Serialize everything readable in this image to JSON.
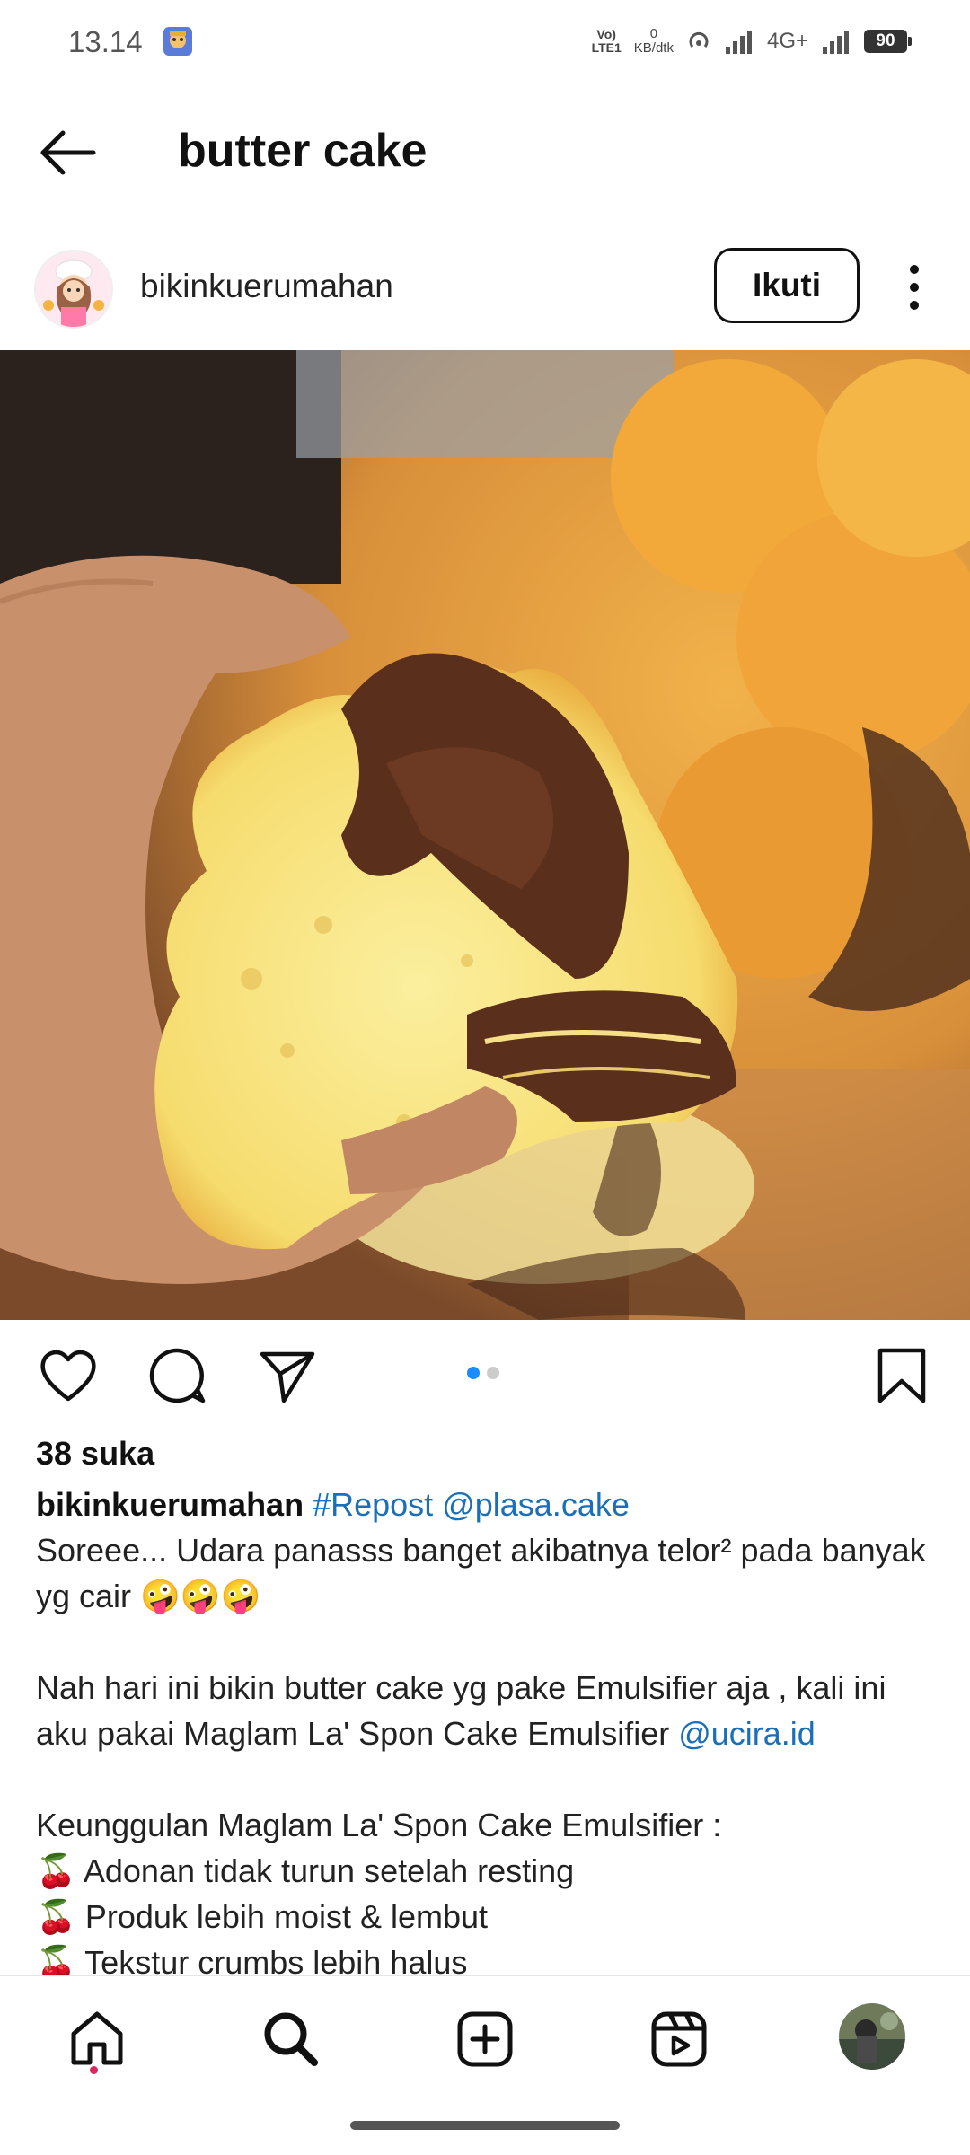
{
  "status_bar": {
    "time": "13.14",
    "volte": "Vo)\nLTE1",
    "speed_value": "0",
    "speed_unit": "KB/dtk",
    "network": "4G+",
    "battery": "90"
  },
  "header": {
    "title": "butter cake"
  },
  "post": {
    "username": "bikinkuerumahan",
    "follow_label": "Ikuti",
    "likes": "38 suka",
    "carousel": {
      "index": 1,
      "total": 2
    },
    "caption": {
      "author": "bikinkuerumahan",
      "hashtag": "#Repost",
      "mention1": "@plasa.cake",
      "line1": "Soreee... Udara panasss banget akibatnya telor² pada banyak yg cair 🤪🤪🤪",
      "line2": "Nah hari ini bikin butter cake yg pake Emulsifier aja , kali ini aku pakai Maglam La' Spon Cake Emulsifier",
      "mention2": "@ucira.id",
      "line3": "Keunggulan Maglam La' Spon Cake Emulsifier :",
      "bullet1": "🍒 Adonan tidak turun setelah resting",
      "bullet2": "🍒 Produk lebih moist & lembut",
      "bullet3": "🍒 Tekstur crumbs lebih halus"
    }
  },
  "icons": {
    "back": "arrow-left-icon",
    "more": "more-vertical-icon",
    "like": "heart-icon",
    "comment": "comment-icon",
    "share": "paper-plane-icon",
    "save": "bookmark-icon",
    "nav": [
      "home-icon",
      "search-icon",
      "add-post-icon",
      "reels-icon",
      "profile-avatar"
    ]
  },
  "colors": {
    "link": "#1a6fb8",
    "carousel_active": "#1a8cff",
    "notification_dot": "#e0245e"
  }
}
